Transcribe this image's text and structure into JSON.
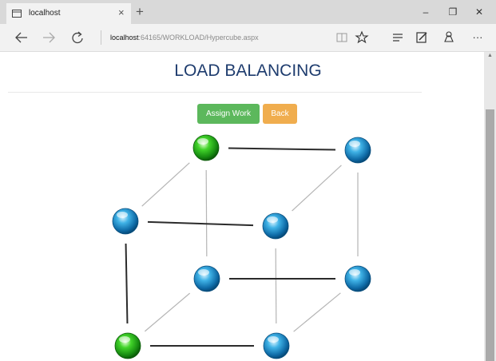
{
  "browser": {
    "tab_title": "localhost",
    "tab_close": "×",
    "new_tab": "+",
    "window_controls": {
      "minimize": "–",
      "restore": "❐",
      "close": "✕"
    },
    "address": {
      "host": "localhost",
      "path": ":64165/WORKLOAD/Hypercube.aspx"
    },
    "nav_icons": [
      "back-arrow-icon",
      "forward-arrow-icon",
      "refresh-icon"
    ],
    "toolbar_icons": [
      "reading-view-icon",
      "favorite-star-icon",
      "hub-icon",
      "web-note-icon",
      "share-icon",
      "more-icon"
    ],
    "more_label": "···"
  },
  "page": {
    "title": "LOAD BALANCING",
    "buttons": {
      "assign": "Assign Work",
      "back": "Back"
    }
  },
  "hypercube": {
    "nodes": [
      {
        "id": "n0",
        "state": "busy",
        "color": "#2fa82f"
      },
      {
        "id": "n1",
        "state": "idle",
        "color": "#1e88c8"
      },
      {
        "id": "n2",
        "state": "idle",
        "color": "#1e88c8"
      },
      {
        "id": "n3",
        "state": "idle",
        "color": "#1e88c8"
      },
      {
        "id": "n4",
        "state": "idle",
        "color": "#1e88c8"
      },
      {
        "id": "n5",
        "state": "idle",
        "color": "#1e88c8"
      },
      {
        "id": "n6",
        "state": "busy",
        "color": "#2fa82f"
      },
      {
        "id": "n7",
        "state": "idle",
        "color": "#1e88c8"
      }
    ],
    "edges": [
      {
        "from": "n0",
        "to": "n1",
        "style": "dark"
      },
      {
        "from": "n0",
        "to": "n2",
        "style": "light"
      },
      {
        "from": "n0",
        "to": "n4",
        "style": "light"
      },
      {
        "from": "n1",
        "to": "n3",
        "style": "light"
      },
      {
        "from": "n1",
        "to": "n5",
        "style": "light"
      },
      {
        "from": "n2",
        "to": "n3",
        "style": "dark"
      },
      {
        "from": "n2",
        "to": "n6",
        "style": "dark"
      },
      {
        "from": "n3",
        "to": "n7",
        "style": "light"
      },
      {
        "from": "n4",
        "to": "n5",
        "style": "dark"
      },
      {
        "from": "n4",
        "to": "n6",
        "style": "light"
      },
      {
        "from": "n5",
        "to": "n7",
        "style": "light"
      },
      {
        "from": "n6",
        "to": "n7",
        "style": "dark"
      }
    ],
    "colors": {
      "dark_edge": "#2b2b2b",
      "light_edge": "#b5b5b5",
      "busy_node": "#2fa82f",
      "idle_node": "#1e88c8"
    }
  }
}
